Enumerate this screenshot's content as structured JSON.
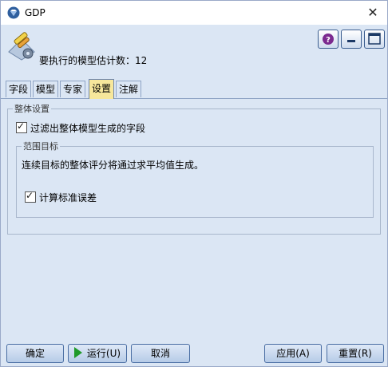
{
  "window": {
    "title": "GDP",
    "close_glyph": "✕"
  },
  "header": {
    "estimate_text": "要执行的模型估计数：12"
  },
  "tabs": [
    {
      "label": "字段"
    },
    {
      "label": "模型"
    },
    {
      "label": "专家"
    },
    {
      "label": "设置"
    },
    {
      "label": "注解"
    }
  ],
  "active_tab": "设置",
  "settings": {
    "ensemble_group_label": "整体设置",
    "filter_fields_label": "过滤出整体模型生成的字段",
    "filter_fields_checked": true,
    "continuous_group_label": "范围目标",
    "continuous_desc": "连续目标的整体评分将通过求平均值生成。",
    "calc_se_label": "计算标准误差",
    "calc_se_checked": true
  },
  "buttons": {
    "ok": "确定",
    "run": "运行(U)",
    "cancel": "取消",
    "apply": "应用(A)",
    "reset": "重置(R)"
  },
  "colors": {
    "header_bg": "#dbe6f4",
    "active_tab": "#f7e79b",
    "run_icon": "#1f9a2a"
  }
}
